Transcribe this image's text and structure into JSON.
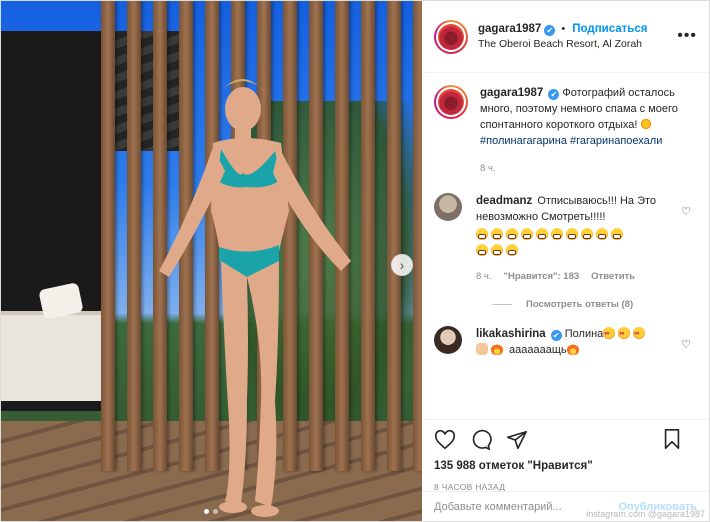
{
  "header": {
    "username": "gagara1987",
    "verified_badge": "✔",
    "follow_label": "Подписаться",
    "separator": "•",
    "location": "The Oberoi Beach Resort, Al Zorah",
    "more_icon": "more-horizontal-icon"
  },
  "caption": {
    "username": "gagara1987",
    "text": "Фотографий осталось много, поэтому немного спама с моего спонтанного короткого отдыха! ",
    "hashtag1": "#полинагагарина",
    "hashtag2": "#гагаринапоехали",
    "time": "8 ч."
  },
  "comments": [
    {
      "username": "deadmanz",
      "text": "Отписываюсь!!! На Это невозможно Смотреть!!!!!",
      "emoji_count": 13,
      "time": "8 ч.",
      "likes": "\"Нравится\": 183",
      "reply_label": "Ответить",
      "view_replies": "Посмотреть ответы (8)"
    },
    {
      "username": "likakashirina",
      "text": "Полина",
      "text2": " ааааааащь"
    }
  ],
  "actions": {
    "likes": "135 988 отметок \"Нравится\"",
    "timestamp": "8 ЧАСОВ НАЗАД"
  },
  "add_comment": {
    "placeholder": "Добавьте комментарий...",
    "publish_label": "Опубликовать"
  },
  "watermark": "instagram.com @gagara1987",
  "carousel": {
    "slide_count": 2,
    "current_slide": 1
  },
  "colors": {
    "accent": "#0095f6",
    "verified": "#3897f0",
    "hashtag": "#00376b",
    "swimsuit": "#1aa3a8"
  }
}
